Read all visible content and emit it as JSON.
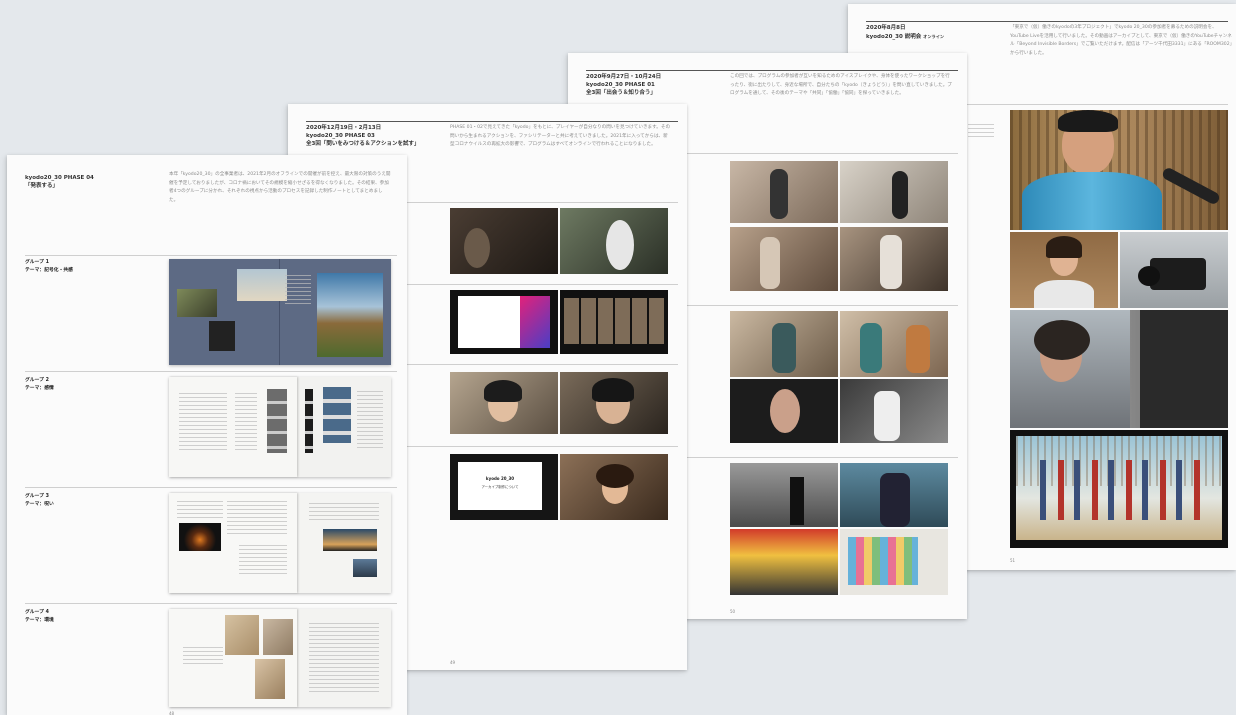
{
  "page4": {
    "title": "kyodo20_30  PHASE 04",
    "subtitle": "「発表する」",
    "body": "本年「kyodo20_30」の全事業者は、2021年2月のオフラインでの開催が前を控え、最大限の対策のうえ開催を予定しておりましたが、コロナ禍においてその規模を縮小せざるを得なくなりました。その結果、参加者4つのグループに分かれ、それぞれの視点から活動のプロセスを記録した制作ノートとしてまとめました。",
    "groups": [
      {
        "label": "グループ 1",
        "theme": "テーマ：記号化・共感"
      },
      {
        "label": "グループ 2",
        "theme": "テーマ：感情"
      },
      {
        "label": "グループ 3",
        "theme": "テーマ：呪い"
      },
      {
        "label": "グループ 4",
        "theme": "テーマ：環境"
      }
    ],
    "page_number": "48"
  },
  "page3": {
    "date": "2020年12月19日・2月13日",
    "title": "kyodo20_30  PHASE 03",
    "subtitle": "全3回「問いをみつける＆アクションを試す」",
    "body": "PHASE 01・02で見えてきた「kyodo」をもとに、プレイヤーが自分なりの問いを見つけていきます。その問いから生まれるアクションを、ファシリテーターと共に考えていきました。2021年に入ってからは、新型コロナウイルスの再拡大の影響で、プログラムはすべてオンラインで行われることになりました。",
    "slide_title": "kyodo 20_30",
    "slide_sub": "アーカイブ制作について",
    "page_number": "49"
  },
  "page2": {
    "date": "2020年9月27日・10月24日",
    "title": "kyodo20_30  PHASE 01",
    "subtitle": "全3回「出会う＆知り合う」",
    "body": "この回では、プログラムの参加者が互いを知るためのアイスブレイクや、身体を使ったワークショップを行ったり、街に出たりして、身近な場所で、自分たちの「kyodo（きょうどう）」を問い直していきました。プログラムを通して、その後のテーマや「共同」「協働」「協同」を探っていきました。",
    "page_number": "50"
  },
  "page1": {
    "date": "2020年8月8日",
    "title": "kyodo20_30 説明会",
    "title_tag": "オンライン",
    "body": "「東京で（仮）働きのkyodoの3年プロジェクト」でkyodo 20_30の参加者を募るための説明会を、YouTube Liveを活用して行いました。その動画はアーカイブとして、東京で（仮）働きのYouTubeチャンネル「Beyond Invisible Borders」でご覧いただけます。配信は「アーツ千代田3331」にある「ROOM302」から行いました。",
    "page_number": "51"
  },
  "colors": {
    "background": "#e4e8ec",
    "paper": "#fbfbfb"
  }
}
